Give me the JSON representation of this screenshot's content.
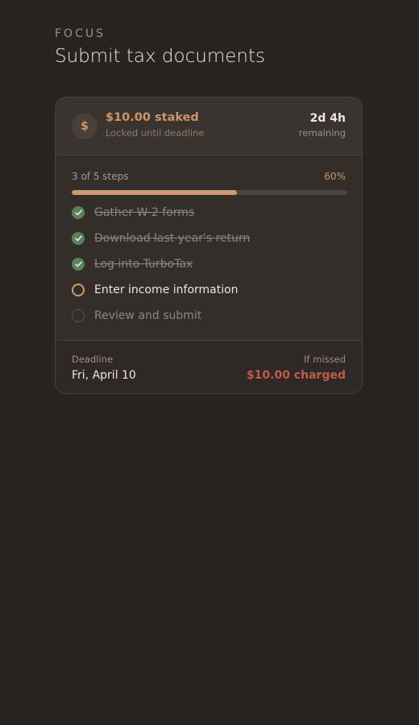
{
  "header": {
    "eyebrow": "FOCUS",
    "title": "Submit tax documents"
  },
  "stake": {
    "icon_symbol": "$",
    "icon": "dollar-coin-icon",
    "amount": "$10.00 staked",
    "subtitle": "Locked until deadline",
    "time_left": "2d 4h",
    "time_label": "remaining"
  },
  "progress": {
    "label": "3 of 5 steps",
    "percent_label": "60%",
    "fraction": 0.6
  },
  "steps": [
    {
      "label": "Gather W-2 forms",
      "status": "done"
    },
    {
      "label": "Download last year's return",
      "status": "done"
    },
    {
      "label": "Log into TurboTax",
      "status": "done"
    },
    {
      "label": "Enter income information",
      "status": "current"
    },
    {
      "label": "Review and submit",
      "status": "todo"
    }
  ],
  "footer": {
    "deadline_label": "Deadline",
    "deadline_value": "Fri, April 10",
    "missed_label": "If missed",
    "missed_value": "$10.00 charged"
  },
  "colors": {
    "background": "#272320",
    "card": "#332e2a",
    "accent": "#cf9a6c",
    "done_green": "#5d7f5a",
    "danger": "#c45a45"
  }
}
